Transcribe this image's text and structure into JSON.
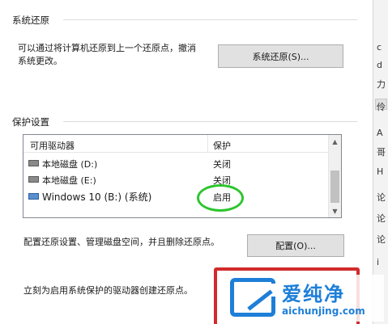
{
  "system_restore": {
    "group_title": "系统还原",
    "description_line1": "可以通过将计算机还原到上一个还原点，撤消",
    "description_line2": "系统更改。",
    "button_label": "系统还原(S)..."
  },
  "protection": {
    "group_title": "保护设置",
    "columns": [
      "可用驱动器",
      "保护"
    ],
    "drives": [
      {
        "name": "本地磁盘 (D:)",
        "status": "关闭",
        "icon": "hard-drive-icon"
      },
      {
        "name": "本地磁盘 (E:)",
        "status": "关闭",
        "icon": "hard-drive-icon"
      },
      {
        "name": "Windows 10 (B:) (系统)",
        "status": "启用",
        "icon": "system-drive-icon"
      }
    ],
    "configure_description": "配置还原设置、管理磁盘空间，并且删除还原点。",
    "configure_button": "配置(O)...",
    "create_description": "立刻为启用系统保护的驱动器创建还原点。"
  },
  "right_panel": {
    "chars": [
      "c",
      "d",
      "力",
      "伶",
      "A",
      "哥",
      "H",
      "论",
      "论",
      "论",
      "i"
    ]
  },
  "watermark": {
    "title": "爱纯净",
    "url": "aichunjing.com"
  },
  "colors": {
    "highlight_circle": "#2ec52e",
    "annotation_box": "#d22b2b",
    "watermark_blue": "#1e7fd8"
  }
}
